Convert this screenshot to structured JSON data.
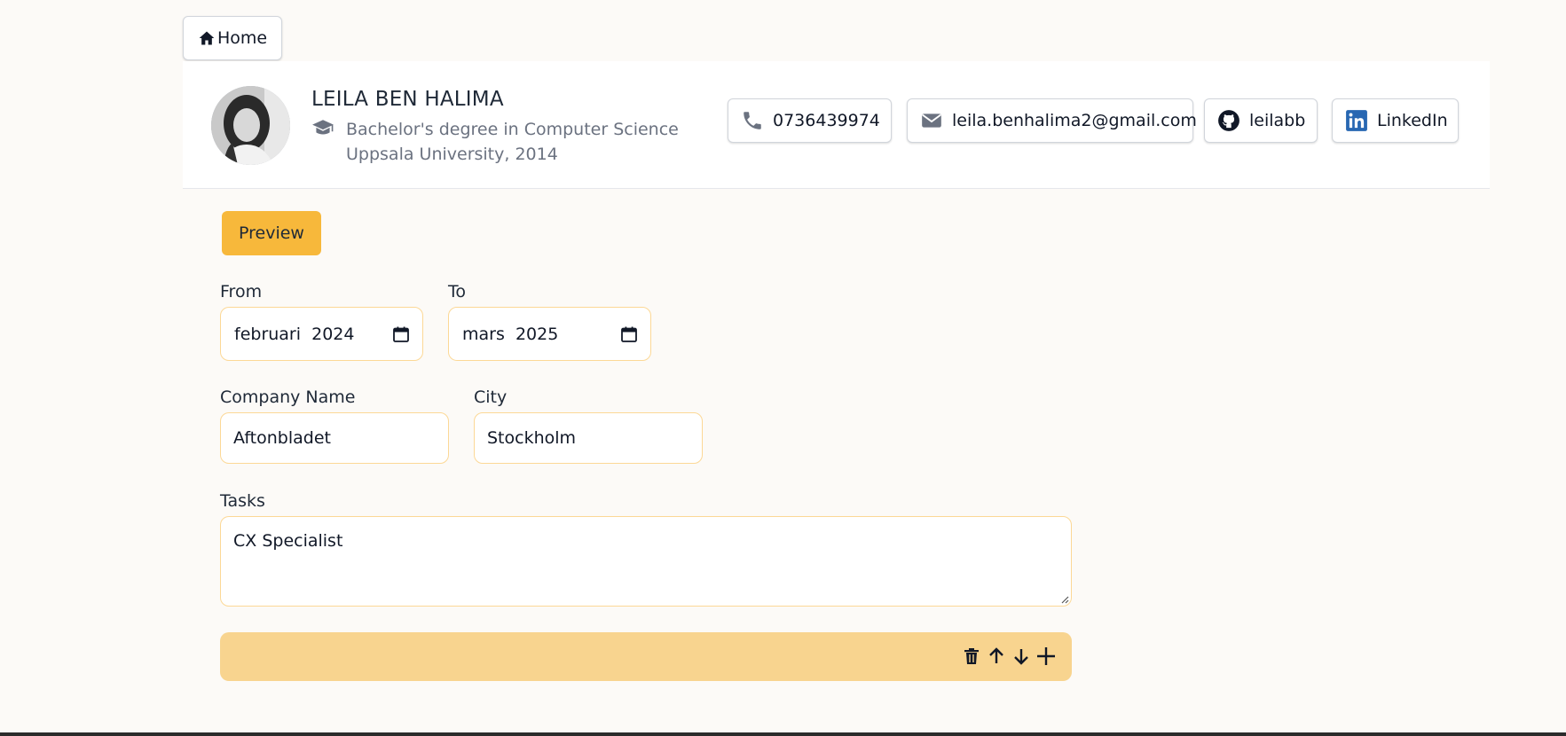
{
  "nav": {
    "home_label": "Home"
  },
  "profile": {
    "name": "LEILA BEN HALIMA",
    "degree": "Bachelor's degree in Computer Science",
    "university": "Uppsala University, 2014",
    "contacts": {
      "phone": "0736439974",
      "email": "leila.benhalima2@gmail.com",
      "github": "leilabb",
      "linkedin": "LinkedIn"
    }
  },
  "actions": {
    "preview_label": "Preview"
  },
  "form": {
    "from": {
      "label": "From",
      "value": "februari  2024"
    },
    "to": {
      "label": "To",
      "value": "mars  2025"
    },
    "company": {
      "label": "Company Name",
      "value": "Aftonbladet"
    },
    "city": {
      "label": "City",
      "value": "Stockholm"
    },
    "tasks": {
      "label": "Tasks",
      "value": "CX Specialist"
    }
  },
  "icons": [
    "home-icon",
    "graduation-cap-icon",
    "phone-icon",
    "mail-icon",
    "github-icon",
    "linkedin-icon",
    "calendar-icon",
    "trash-icon",
    "arrow-up-icon",
    "arrow-down-icon",
    "plus-icon"
  ],
  "colors": {
    "accent": "#f7b83b",
    "toolbar": "#f8d48f",
    "field_border": "#fcd896",
    "linkedin": "#2867b2"
  }
}
